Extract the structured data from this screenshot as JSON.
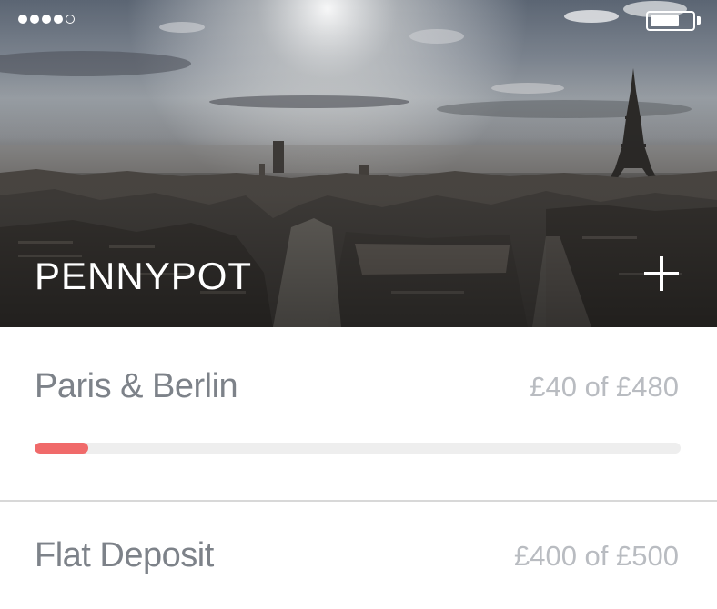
{
  "header": {
    "title": "PENNYPOT",
    "signal": {
      "filled": 4,
      "total": 5
    },
    "battery_level": 0.7,
    "add_icon": "plus-icon"
  },
  "pots": [
    {
      "name": "Paris & Berlin",
      "amount_text": "£40 of £480",
      "saved": 40,
      "goal": 480
    },
    {
      "name": "Flat Deposit",
      "amount_text": "£400 of £500",
      "saved": 400,
      "goal": 500
    }
  ],
  "colors": {
    "accent": "#f06a6a",
    "text": "#7d8289",
    "muted": "#b9bcc1",
    "track": "#eeeeee",
    "divider": "#d8d8d8"
  }
}
